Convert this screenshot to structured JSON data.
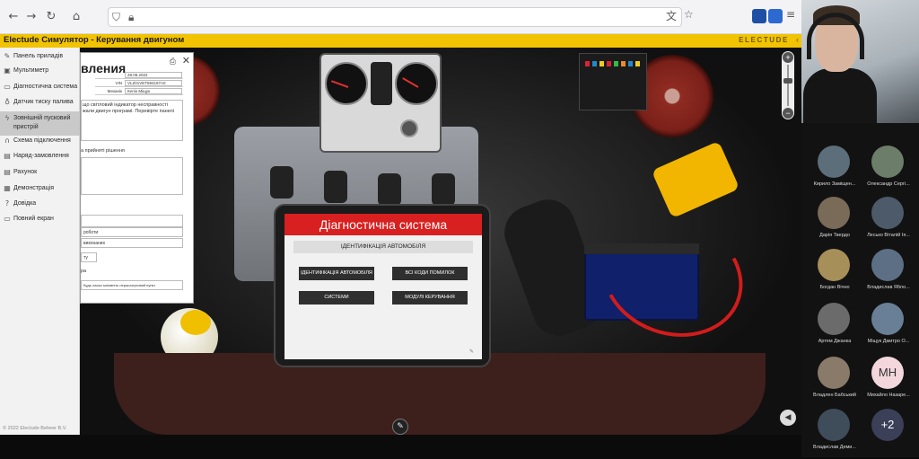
{
  "app": {
    "title": "Electude Симулятор - Керування двигуном",
    "brand": "ELECTUDE",
    "copyright": "© 2022 Electude Beheer B.V."
  },
  "sidebar": {
    "items": [
      {
        "label": "Панель приладів",
        "icon": "gauge-icon"
      },
      {
        "label": "Мультиметр",
        "icon": "multimeter-icon"
      },
      {
        "label": "Діагностична система",
        "icon": "diagnostic-system-icon"
      },
      {
        "label": "Датчик тиску палива",
        "icon": "pressure-sensor-icon"
      },
      {
        "label": "Зовнішній пусковий пристрій",
        "icon": "jump-starter-icon"
      },
      {
        "label": "Схема підключення",
        "icon": "wiring-diagram-icon"
      },
      {
        "label": "Наряд-замовлення",
        "icon": "work-order-icon"
      },
      {
        "label": "Рахунок",
        "icon": "invoice-icon"
      },
      {
        "label": "Демонстрація",
        "icon": "demonstration-icon"
      },
      {
        "label": "Довідка",
        "icon": "help-icon"
      },
      {
        "label": "Повний екран",
        "icon": "fullscreen-icon"
      }
    ]
  },
  "work_order": {
    "title_fragment": "вления",
    "fields": [
      {
        "value": "28.06.2022"
      },
      {
        "key": "VIN",
        "value": "VLZ01VET594197A0"
      },
      {
        "key": "Механік",
        "value": "Келін Міщук"
      }
    ],
    "complaint_line1": "що світловий індикатор несправності",
    "complaint_line2": "жали двигун програмі. Перевірте панелі",
    "decision_label": "а прийняті рішення",
    "row_work": "роботи",
    "row_done": "виконаних",
    "row_extra": "ту",
    "footer_fragment": "ра",
    "footer_input": "Будь ласка заповніть першочерговий пункт"
  },
  "tablet": {
    "header": "Діагностична система",
    "subheader": "ІДЕНТИФІКАЦІЯ АВТОМОБІЛЯ",
    "buttons": [
      "ІДЕНТИФІКАЦІЯ АВТОМОБІЛЯ",
      "ВСІ КОДИ ПОМИЛОК",
      "СИСТЕМИ",
      "МОДУЛІ КЕРУВАННЯ"
    ]
  },
  "participants": [
    {
      "name": "Кирило Заміщен...",
      "avatar_color": "#5b6e7a"
    },
    {
      "name": "Олександр Сергі...",
      "avatar_color": "#6c7d6a"
    },
    {
      "name": "Дарія Твердо",
      "avatar_color": "#7a6a58"
    },
    {
      "name": "Лесько Віталій Ія...",
      "avatar_color": "#4c5a6a"
    },
    {
      "name": "Богдан Вічно",
      "avatar_color": "#a78f5a"
    },
    {
      "name": "Владислав Ябло...",
      "avatar_color": "#5d6f84"
    },
    {
      "name": "Артем Джанка",
      "avatar_color": "#6b6b6b"
    },
    {
      "name": "Міщук Дмитро О...",
      "avatar_color": "#687f95"
    },
    {
      "name": "Владлен Бабський",
      "avatar_color": "#8a7a6a"
    },
    {
      "name": "Михайло Назаре...",
      "avatar_color": "#f3d7dc",
      "initials": "MH"
    },
    {
      "name": "Владислав Деми...",
      "avatar_color": "#3f4c5a"
    },
    {
      "name": "",
      "avatar_color": "#3b3f58",
      "initials": "+2"
    }
  ]
}
